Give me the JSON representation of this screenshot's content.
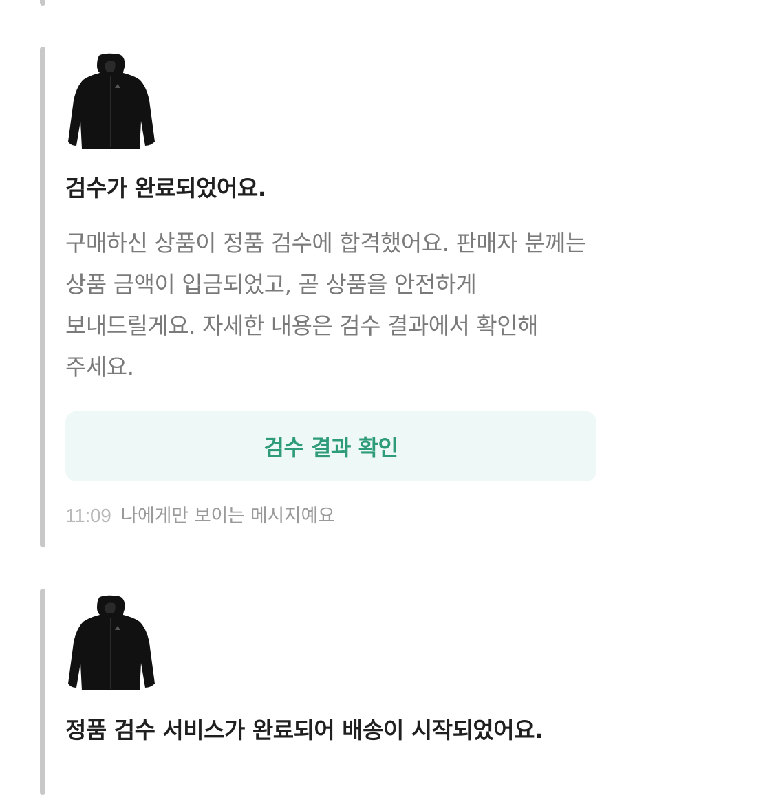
{
  "messages": [
    {
      "image": "black-hooded-jacket-thumbnail",
      "title": "검수가 완료되었어요.",
      "body": "구매하신 상품이 정품 검수에 합격했어요. 판매자 분께는 상품 금액이 입금되었고, 곧 상품을 안전하게 보내드릴게요. 자세한 내용은 검수 결과에서 확인해 주세요.",
      "button_label": "검수 결과 확인",
      "time": "11:09",
      "visibility_note": "나에게만 보이는 메시지예요"
    },
    {
      "image": "black-hooded-jacket-thumbnail",
      "title": "정품 검수 서비스가 완료되어 배송이 시작되었어요."
    }
  ],
  "colors": {
    "accent_text": "#2e9c7a",
    "accent_bg": "#eef8f6",
    "side_bar": "#c8c8c8"
  }
}
